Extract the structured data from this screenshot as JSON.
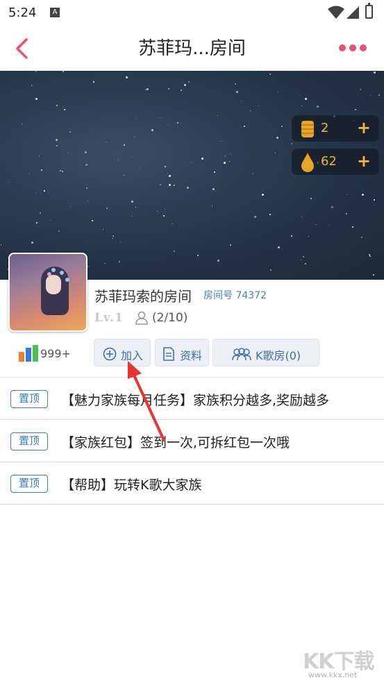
{
  "status_bar": {
    "time": "5:24",
    "notification_icon": "A"
  },
  "header": {
    "title": "苏菲玛...房间"
  },
  "wallet": [
    {
      "icon": "coin-icon",
      "value": "2",
      "plus": "+"
    },
    {
      "icon": "drop-icon",
      "value": "62",
      "plus": "+"
    }
  ],
  "room": {
    "name": "苏菲玛索的房间",
    "number_label": "房间号 74372",
    "level": "Lv.1",
    "members": "(2/10)",
    "rank": "999+"
  },
  "actions": {
    "join": "加入",
    "profile": "资料",
    "karaoke": "K歌房(0)"
  },
  "pinned": [
    {
      "tag": "置顶",
      "text": "【魅力家族每月任务】家族积分越多,奖励越多"
    },
    {
      "tag": "置顶",
      "text": "【家族红包】签到一次,可拆红包一次哦"
    },
    {
      "tag": "置顶",
      "text": "【帮助】玩转K歌大家族"
    }
  ],
  "watermark": {
    "big": "KK下载",
    "small": "www.kkx.net"
  },
  "colors": {
    "accent": "#e8506f",
    "link": "#3f6ea8",
    "gold": "#f0b53a",
    "tag_blue": "#3a7bd5",
    "arrow": "#e8342e"
  }
}
